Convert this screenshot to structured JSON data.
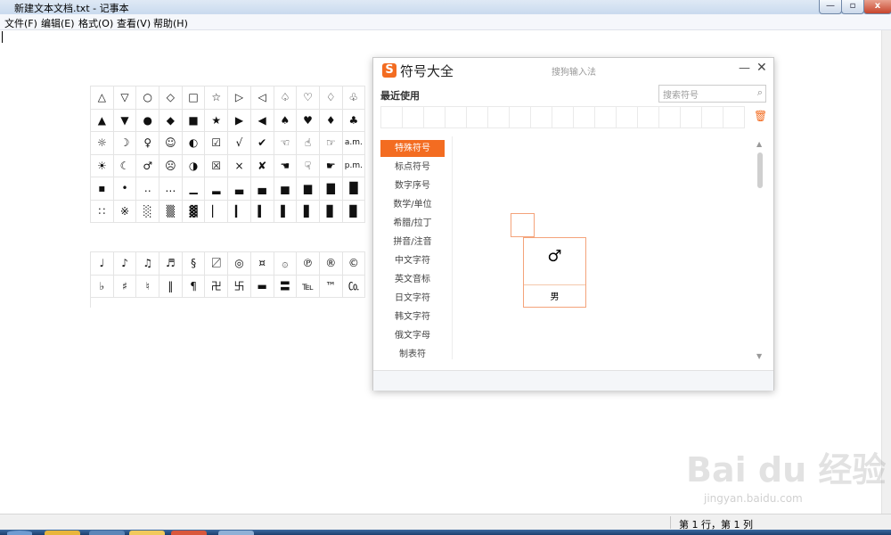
{
  "window": {
    "title": "新建文本文档.txt - 记事本",
    "minimize": "—",
    "maximize": "▫",
    "close": "x"
  },
  "menu": [
    "文件(F)",
    "编辑(E)",
    "格式(O)",
    "查看(V)",
    "帮助(H)"
  ],
  "status": {
    "position": "第 1 行，第 1 列"
  },
  "symbol_panel": {
    "logo": "S",
    "title": "符号大全",
    "subtitle": "搜狗输入法",
    "minimize": "—",
    "close": "✕",
    "recent_label": "最近使用",
    "search_placeholder": "搜索符号",
    "search_icon": "search-icon",
    "trash_icon": "trash-icon",
    "categories": [
      "特殊符号",
      "标点符号",
      "数字序号",
      "数学/单位",
      "希腊/拉丁",
      "拼音/注音",
      "中文字符",
      "英文音标",
      "日文字符",
      "韩文字符",
      "俄文字母",
      "制表符"
    ],
    "active_category": "特殊符号",
    "grid1": [
      [
        "△",
        "▽",
        "○",
        "◇",
        "□",
        "☆",
        "▷",
        "◁",
        "♤",
        "♡",
        "♢",
        "♧"
      ],
      [
        "▲",
        "▼",
        "●",
        "◆",
        "■",
        "★",
        "▶",
        "◀",
        "♠",
        "♥",
        "♦",
        "♣"
      ],
      [
        "☼",
        "☽",
        "♀",
        "☺",
        "◐",
        "☑",
        "√",
        "✔",
        "☜",
        "☝",
        "☞",
        "a.m."
      ],
      [
        "☀",
        "☾",
        "♂",
        "☹",
        "◑",
        "☒",
        "×",
        "✘",
        "☚",
        "☟",
        "☛",
        "p.m."
      ],
      [
        "▪",
        "•",
        "‥",
        "…",
        "▁",
        "▂",
        "▃",
        "▄",
        "▅",
        "▆",
        "▇",
        "█"
      ],
      [
        "∷",
        "※",
        "░",
        "▒",
        "▓",
        "▏",
        "▎",
        "▍",
        "▌",
        "▋",
        "▊",
        "▉"
      ]
    ],
    "grid2": [
      [
        "♩",
        "♪",
        "♫",
        "♬",
        "§",
        "〼",
        "◎",
        "¤",
        "۞",
        "℗",
        "®",
        "©"
      ],
      [
        "♭",
        "♯",
        "♮",
        "‖",
        "¶",
        "卍",
        "卐",
        "▬",
        "〓",
        "℡",
        "™",
        "㏇"
      ]
    ],
    "popup": {
      "symbol": "♂",
      "name": "男"
    }
  },
  "watermark": {
    "brand": "Bai du 经验",
    "url": "jingyan.baidu.com"
  }
}
